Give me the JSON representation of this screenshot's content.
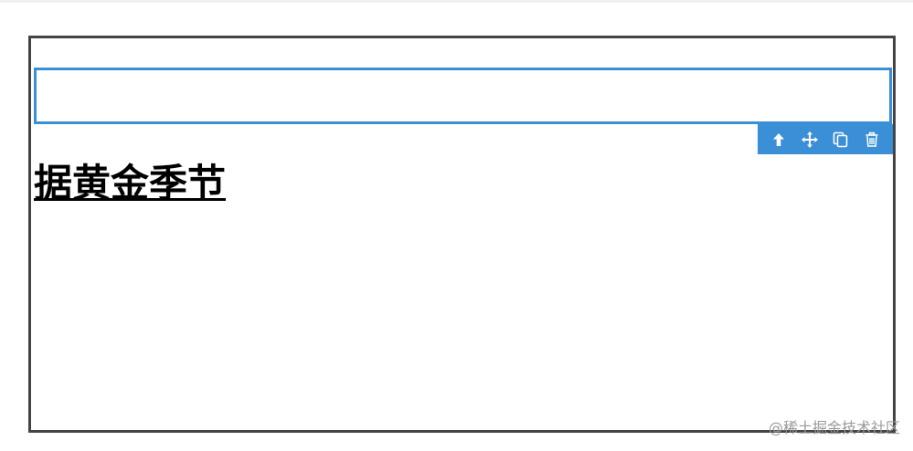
{
  "canvas": {
    "heading_text": "据黄金季节"
  },
  "toolbar": {
    "buttons": [
      {
        "icon": "arrow-up-icon",
        "action": "move-up"
      },
      {
        "icon": "move-icon",
        "action": "drag"
      },
      {
        "icon": "copy-icon",
        "action": "duplicate"
      },
      {
        "icon": "trash-icon",
        "action": "delete"
      }
    ]
  },
  "watermark": {
    "text": "@稀土掘金技术社区"
  },
  "colors": {
    "accent": "#3a8fd6",
    "frame": "#444444",
    "text": "#000000"
  }
}
